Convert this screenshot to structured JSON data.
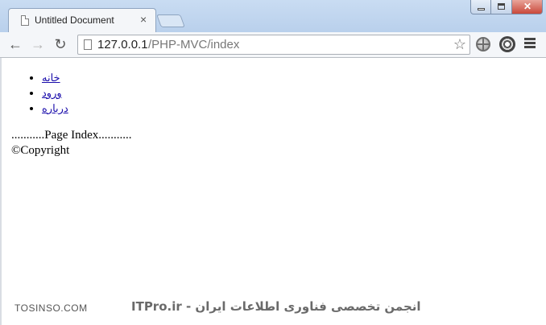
{
  "browser": {
    "tab": {
      "title": "Untitled Document",
      "close_glyph": "×"
    },
    "window_controls": {
      "close_glyph": "✕"
    },
    "toolbar": {
      "back_glyph": "←",
      "forward_glyph": "→",
      "reload_glyph": "↻",
      "url_host": "127.0.0.1",
      "url_path": "/PHP-MVC/index",
      "star_glyph": "☆"
    },
    "icons": {
      "tab_page": "page-icon",
      "extension_1": "globe-icon",
      "extension_2": "film-reel-icon",
      "menu": "hamburger-menu-icon"
    }
  },
  "page": {
    "nav_items": [
      {
        "label": "خانه"
      },
      {
        "label": "ورود"
      },
      {
        "label": "درباره"
      }
    ],
    "body_text": "...........Page Index...........",
    "footer_text": "©Copyright"
  },
  "watermark": {
    "left_text": "TOSINSO.COM",
    "right_text": "ITPro.ir - انجمن تخصصی فناوری اطلاعات ایران"
  }
}
